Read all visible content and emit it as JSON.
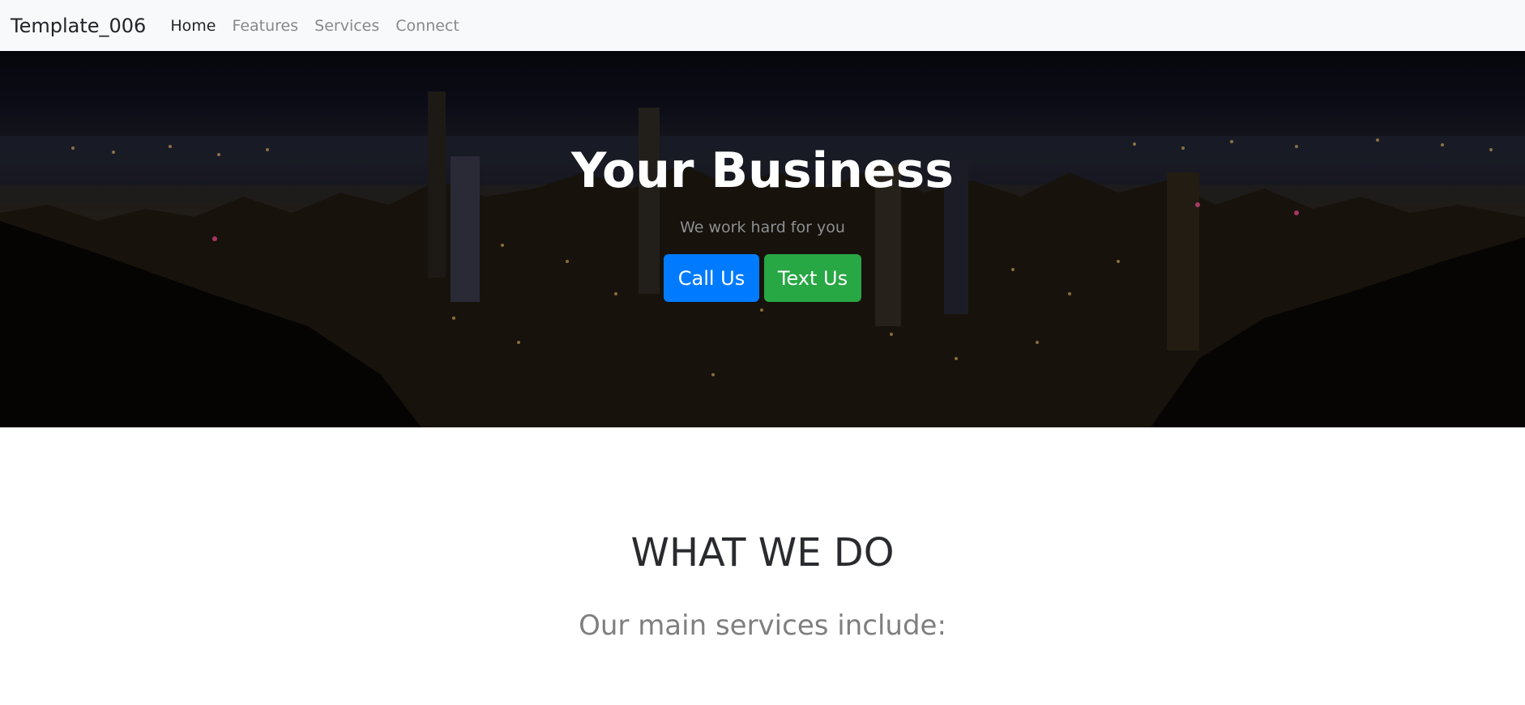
{
  "navbar": {
    "brand": "Template_006",
    "links": [
      {
        "label": "Home",
        "active": true
      },
      {
        "label": "Features",
        "active": false
      },
      {
        "label": "Services",
        "active": false
      },
      {
        "label": "Connect",
        "active": false
      }
    ]
  },
  "hero": {
    "title": "Your Business",
    "subtitle": "We work hard for you",
    "buttons": {
      "call_label": "Call Us",
      "text_label": "Text Us"
    },
    "background_image": "night-city-skyline"
  },
  "section": {
    "title": "WHAT WE DO",
    "subtitle": "Our main services include:"
  },
  "colors": {
    "primary": "#007bff",
    "success": "#28a745",
    "navbar_bg": "#f8f9fa"
  }
}
